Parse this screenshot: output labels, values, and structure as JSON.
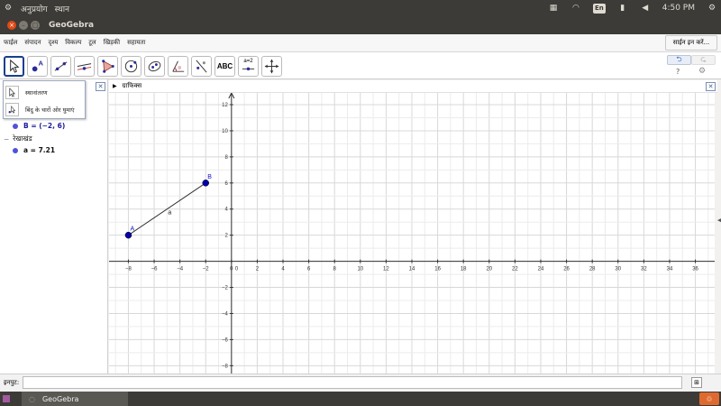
{
  "system": {
    "apps_menu": "अनुप्रयोग",
    "places_menu": "स्थान",
    "keyboard_layout": "En",
    "clock": "4:50 PM"
  },
  "window": {
    "title": "GeoGebra"
  },
  "menubar": {
    "items": [
      "फाईल",
      "संपादन",
      "दृश्य",
      "विकल्प",
      "टूल",
      "खिड़की",
      "सहायता"
    ],
    "signin_label": "साईन इन करें..."
  },
  "toolbar": {
    "tools": [
      {
        "name": "move-tool",
        "icon": "arrow-cursor"
      },
      {
        "name": "point-tool",
        "icon": "point-A"
      },
      {
        "name": "line-tool",
        "icon": "line"
      },
      {
        "name": "perpendicular-line-tool",
        "icon": "perpendicular"
      },
      {
        "name": "polygon-tool",
        "icon": "polygon"
      },
      {
        "name": "circle-tool",
        "icon": "circle-center"
      },
      {
        "name": "ellipse-tool",
        "icon": "ellipse"
      },
      {
        "name": "angle-tool",
        "icon": "angle"
      },
      {
        "name": "reflect-tool",
        "icon": "reflect-line"
      },
      {
        "name": "text-tool",
        "icon": "ABC",
        "label": "ABC"
      },
      {
        "name": "slider-tool",
        "icon": "slider",
        "label": "a=2"
      },
      {
        "name": "move-graphics-tool",
        "icon": "move-cross"
      }
    ],
    "help_label": "?",
    "undo_icon": "undo-icon",
    "redo_icon": "redo-icon"
  },
  "dropdown": {
    "items": [
      "स्थानांतरण",
      "बिंदु के चारों ओर घुमाएं"
    ]
  },
  "algebra": {
    "point_b": "B = (−2, 6)",
    "segment_header": "रेखाखंड",
    "segment_a": "a = 7.21"
  },
  "graphics": {
    "header_label": "ग्राफिक्स",
    "point_a_label": "A",
    "point_b_label": "B",
    "segment_label": "a",
    "point_a": {
      "x": -8,
      "y": 2
    },
    "point_b": {
      "x": -2,
      "y": 6
    },
    "x_ticks": [
      -8,
      -6,
      -4,
      -2,
      0,
      2,
      4,
      6,
      8,
      10,
      12,
      14,
      16,
      18,
      20,
      22,
      24,
      26,
      28,
      30,
      32,
      34,
      36
    ],
    "y_ticks": [
      -8,
      -6,
      -4,
      -2,
      2,
      4,
      6,
      8,
      10,
      12
    ],
    "xlim": [
      -9.5,
      37.5
    ],
    "ylim": [
      -8.6,
      12.9
    ],
    "accent_color": "#1111cc",
    "point_color": "#0000aa"
  },
  "inputbar": {
    "label": "इनपुट:"
  },
  "taskbar": {
    "task_label": "GeoGebra"
  }
}
